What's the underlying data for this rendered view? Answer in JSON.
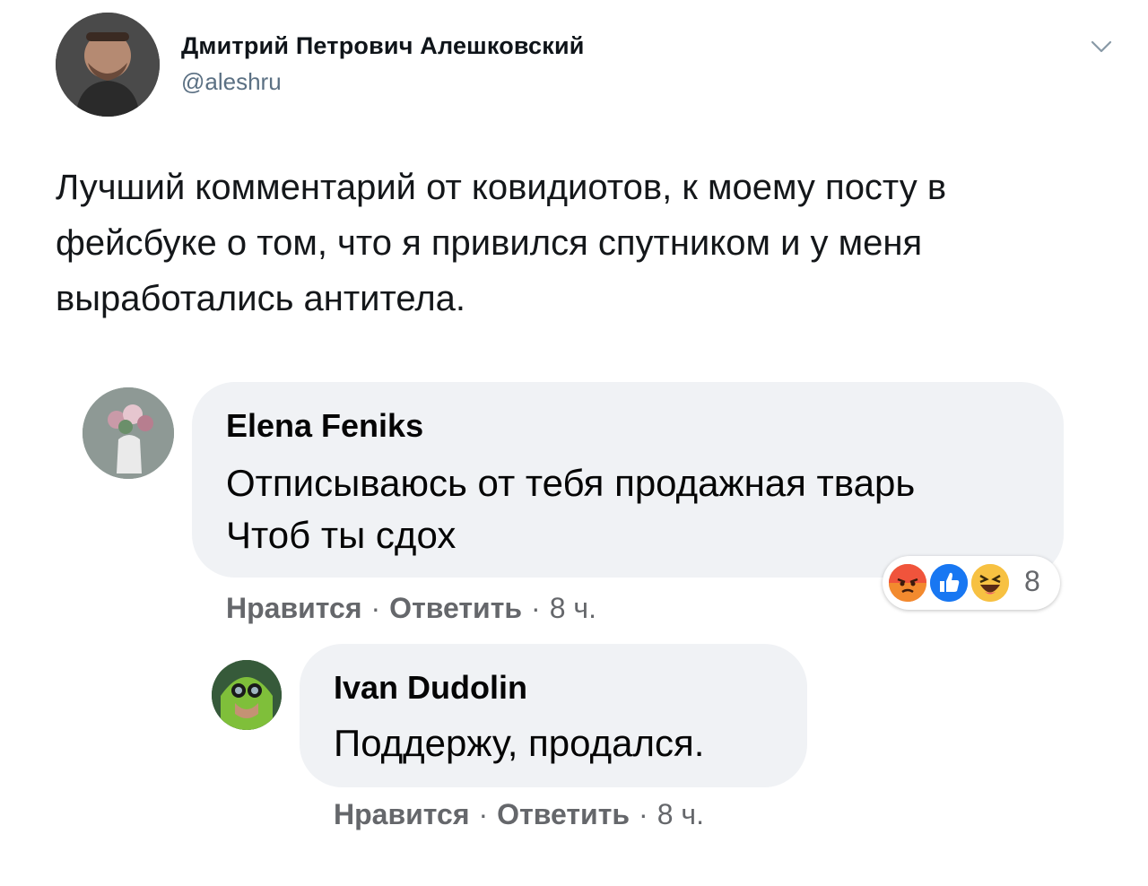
{
  "tweet": {
    "display_name": "Дмитрий Петрович Алешковский",
    "handle": "@aleshru",
    "text": "Лучший комментарий от ковидиотов, к моему посту в фейсбуке о том, что я привился спутником и у меня выработались антитела."
  },
  "comments": [
    {
      "author": "Elena Feniks",
      "line1": "Отписываюсь от тебя продажная тварь",
      "line2": "Чтоб ты сдох",
      "like_label": "Нравится",
      "reply_label": "Ответить",
      "time": "8 ч.",
      "reactions": [
        "angry-icon",
        "like-icon",
        "haha-icon"
      ],
      "reaction_count": "8"
    },
    {
      "author": "Ivan Dudolin",
      "line1": "Поддержу, продался.",
      "like_label": "Нравится",
      "reply_label": "Ответить",
      "time": "8 ч."
    }
  ],
  "colors": {
    "bubble": "#f0f2f5",
    "meta": "#65676b",
    "handle": "#5b7083",
    "like_blue": "#1877f2",
    "angry_orange": "#f7714c"
  }
}
